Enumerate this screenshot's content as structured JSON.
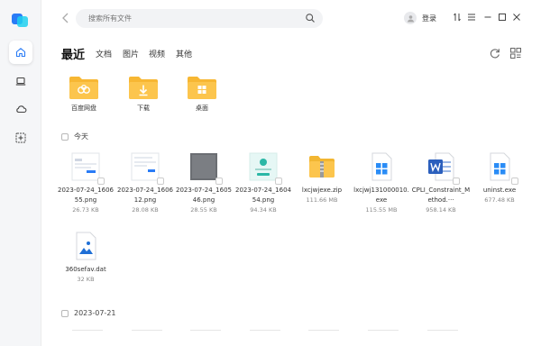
{
  "search": {
    "placeholder": "搜索所有文件"
  },
  "header": {
    "login_label": "登录"
  },
  "main": {
    "title": "最近",
    "tabs": [
      {
        "label": "文档"
      },
      {
        "label": "图片"
      },
      {
        "label": "视频"
      },
      {
        "label": "其他"
      }
    ]
  },
  "folders": [
    {
      "label": "百度网盘",
      "icon": "baidu-netdisk-folder-icon"
    },
    {
      "label": "下载",
      "icon": "download-folder-icon"
    },
    {
      "label": "桌面",
      "icon": "desktop-folder-icon"
    }
  ],
  "sections": [
    {
      "label": "今天",
      "files": [
        {
          "name": "2023-07-24_160655.png",
          "size": "26.73 KB",
          "icon": "screenshot-thumbnail"
        },
        {
          "name": "2023-07-24_160612.png",
          "size": "28.08 KB",
          "icon": "screenshot-thumbnail"
        },
        {
          "name": "2023-07-24_160546.png",
          "size": "28.55 KB",
          "icon": "dark-screenshot-thumbnail"
        },
        {
          "name": "2023-07-24_160454.png",
          "size": "94.34 KB",
          "icon": "app-screenshot-thumbnail"
        },
        {
          "name": "lxcjwjexe.zip",
          "size": "111.66 MB",
          "icon": "zip-archive-icon"
        },
        {
          "name": "lxcjwj131000010.exe",
          "size": "115.55 MB",
          "icon": "windows-exe-icon"
        },
        {
          "name": "CPLI_Constraint_Method.···",
          "size": "958.14 KB",
          "icon": "word-document-icon"
        },
        {
          "name": "uninst.exe",
          "size": "677.48 KB",
          "icon": "windows-exe-icon"
        },
        {
          "name": "360sefav.dat",
          "size": "32 KB",
          "icon": "image-file-icon"
        }
      ]
    },
    {
      "label": "2023-07-21"
    }
  ],
  "colors": {
    "accent": "#2a7cf6",
    "folder": "#fcc54d",
    "sidebar": "#f5f6f8"
  }
}
